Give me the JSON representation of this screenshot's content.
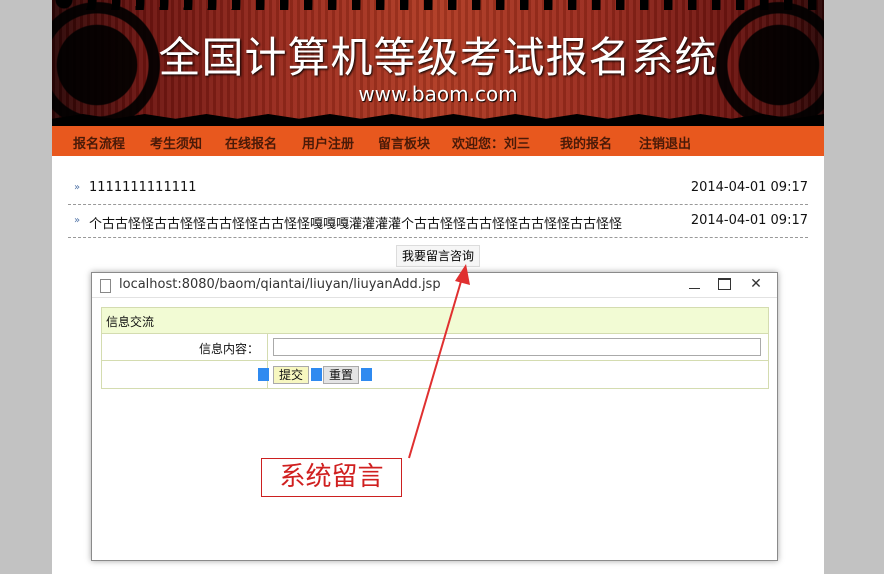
{
  "banner": {
    "title": "全国计算机等级考试报名系统",
    "url": "www.baom.com"
  },
  "nav": {
    "items": [
      "报名流程",
      "考生须知",
      "在线报名",
      "用户注册",
      "留言板块",
      "欢迎您：刘三",
      "我的报名",
      "注销退出"
    ]
  },
  "messages": [
    {
      "title": "1111111111111",
      "date": "2014-04-01 09:17"
    },
    {
      "title": "个古古怪怪古古怪怪古古怪怪古古怪怪嘎嘎嘎灌灌灌灌个古古怪怪古古怪怪古古怪怪古古怪怪",
      "date": "2014-04-01 09:17"
    }
  ],
  "ask_button": "我要留言咨询",
  "popup": {
    "url": "localhost:8080/baom/qiantai/liuyan/liuyanAdd.jsp",
    "form_title": "信息交流",
    "field_label": "信息内容：",
    "field_value": "",
    "submit_label": "提交",
    "reset_label": "重置"
  },
  "annotation": {
    "label": "系统留言",
    "color": "#d02020"
  },
  "colors": {
    "nav_bg": "#e8581e",
    "form_head_bg": "#f2fbd4"
  }
}
